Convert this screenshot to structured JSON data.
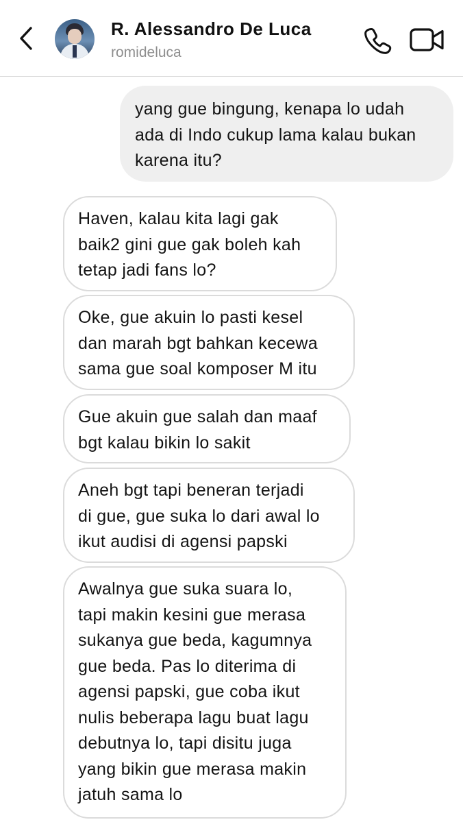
{
  "header": {
    "contact_name": "R. Alessandro De Luca",
    "contact_handle": "romideluca",
    "icons": {
      "back": "chevron-left-icon",
      "avatar": "profile-photo",
      "call": "phone-icon",
      "video": "video-camera-icon"
    }
  },
  "messages": [
    {
      "direction": "sent",
      "text": "yang gue bingung, kenapa lo udah\nada di Indo cukup lama kalau bukan\nkarena itu?"
    },
    {
      "direction": "received",
      "text": "Haven, kalau kita lagi gak\nbaik2 gini gue gak boleh kah\ntetap jadi fans lo?"
    },
    {
      "direction": "received",
      "text": "Oke, gue akuin lo pasti kesel\ndan marah bgt bahkan kecewa\nsama gue soal komposer M itu"
    },
    {
      "direction": "received",
      "text": "Gue akuin gue salah dan maaf\nbgt kalau bikin lo sakit"
    },
    {
      "direction": "received",
      "text": "Aneh bgt tapi beneran terjadi\ndi gue, gue suka lo dari awal lo\nikut audisi di agensi papski"
    },
    {
      "direction": "received",
      "text": "Awalnya gue suka suara lo,\ntapi makin kesini gue merasa\nsukanya gue beda, kagumnya\ngue beda. Pas lo diterima di\nagensi papski, gue coba ikut\nnulis beberapa lagu buat lagu\ndebutnya lo, tapi disitu juga\nyang bikin gue merasa makin\njatuh sama lo"
    }
  ],
  "colors": {
    "sent_bubble": "#efefef",
    "received_border": "#dbdbdb",
    "handle_text": "#8e8e8e",
    "text": "#141414"
  }
}
